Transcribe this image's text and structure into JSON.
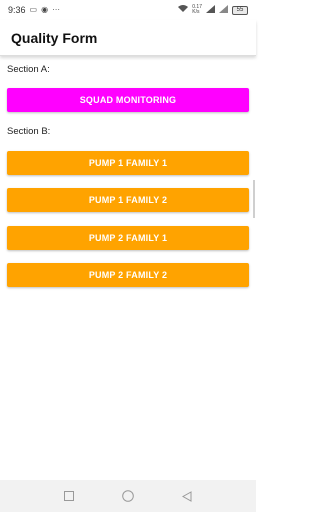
{
  "status_bar": {
    "time": "9:36",
    "speed": "0.17\nK/s",
    "battery": "55"
  },
  "app_bar": {
    "title": "Quality Form"
  },
  "section_a": {
    "label": "Section A:",
    "buttons": [
      "SQUAD MONITORING"
    ]
  },
  "section_b": {
    "label": "Section B:",
    "buttons": [
      "PUMP 1 FAMILY 1",
      "PUMP 1 FAMILY 2",
      "PUMP 2 FAMILY 1",
      "PUMP 2 FAMILY 2"
    ]
  },
  "colors": {
    "section_a_button": "#ff00ff",
    "section_b_button": "#ffa300"
  },
  "icons": {
    "status": [
      "message-icon",
      "location-icon",
      "ellipsis-icon",
      "wifi-icon",
      "signal-icon",
      "battery-icon"
    ],
    "nav": [
      "recent-apps-icon",
      "home-icon",
      "back-icon"
    ]
  }
}
